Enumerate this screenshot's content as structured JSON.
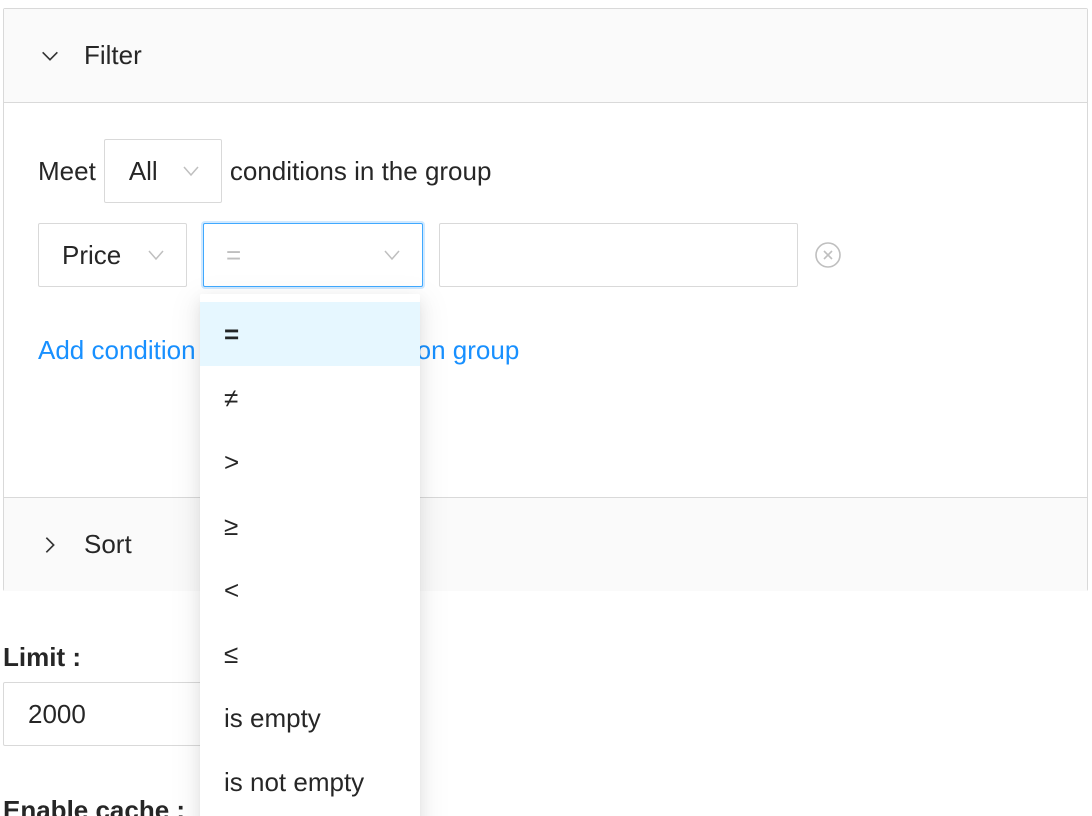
{
  "filter_panel": {
    "title": "Filter",
    "group_line": {
      "prefix": "Meet",
      "match_select_value": "All",
      "suffix": "conditions in the group"
    },
    "condition": {
      "field_select_value": "Price",
      "operator_placeholder": "=",
      "value_input": ""
    },
    "add_condition_label": "Add condition",
    "add_group_label": "Add condition group"
  },
  "sort_panel": {
    "title": "Sort"
  },
  "limit": {
    "label": "Limit :",
    "value": "2000"
  },
  "cache": {
    "label": "Enable cache :"
  },
  "operator_dropdown": {
    "options": [
      "=",
      "≠",
      ">",
      "≥",
      "<",
      "≤",
      "is empty",
      "is not empty"
    ],
    "selected_index": 0
  },
  "colors": {
    "link": "#1890ff",
    "focus_border": "#40a9ff",
    "selected_option_bg": "#e6f7ff",
    "panel_header_bg": "#fafafa",
    "border": "#d9d9d9"
  }
}
